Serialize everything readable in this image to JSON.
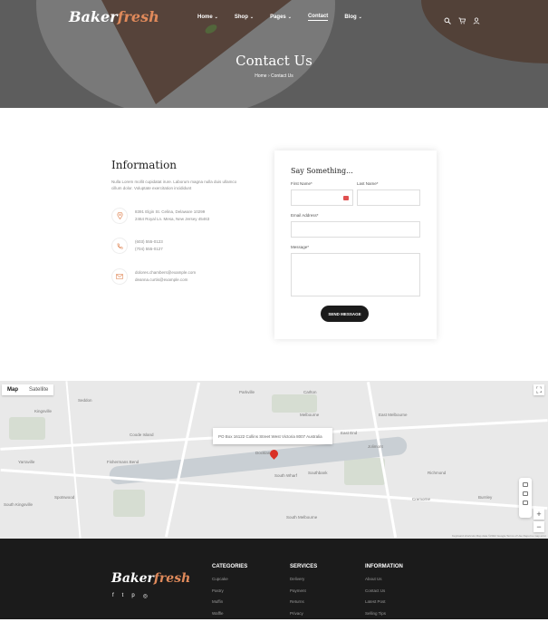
{
  "brand": {
    "name_main": "Baker",
    "name_accent": "fresh"
  },
  "nav": {
    "items": [
      {
        "label": "Home",
        "has_caret": true
      },
      {
        "label": "Shop",
        "has_caret": true
      },
      {
        "label": "Pages",
        "has_caret": true
      },
      {
        "label": "Contact",
        "has_caret": false,
        "active": true
      },
      {
        "label": "Blog",
        "has_caret": true
      }
    ],
    "icons": [
      "search-icon",
      "cart-icon",
      "user-icon"
    ]
  },
  "hero": {
    "title": "Contact Us",
    "breadcrumb": "Home › Contact Us"
  },
  "info": {
    "title": "Information",
    "description": "Nulla Lorem mollit cupidatat irure. Laborum magna nulla duis ullamco cillum dolor. Voluptate exercitation incididunt",
    "address": [
      "8391 Elgin St. Celina, Delaware 10299",
      "2464 Royal Ln. Mesa, New Jersey 45463"
    ],
    "phones": [
      "(603) 555-0123",
      "(704) 555-0127"
    ],
    "emails": [
      "dolores.chambers@example.com",
      "deanna.curtis@example.com"
    ]
  },
  "form": {
    "title": "Say Something...",
    "first_name_label": "First Name*",
    "last_name_label": "Last Name*",
    "email_label": "Email Address*",
    "message_label": "Message*",
    "submit_label": "SEND MESSAGE"
  },
  "map": {
    "tab_map": "Map",
    "tab_satellite": "Satellite",
    "info_address": "PO Box 16122 Collins Street West Victoria 8007 Australia",
    "labels": [
      "Seddon",
      "Kingsville",
      "Yarraville",
      "Spotswood",
      "South Kingsville",
      "Docklands",
      "South Wharf",
      "Southbank",
      "South Melbourne",
      "East Melbourne",
      "Jolimont",
      "Richmond",
      "Cremorne",
      "Burnley",
      "Melbourne",
      "Carlton",
      "Fishermans Bend",
      "Coode Island",
      "East End",
      "Parkville"
    ],
    "attribution": "Keyboard shortcuts  Map data ©2022 Google  Terms of Use  Report a map error"
  },
  "footer": {
    "social": [
      "f",
      "t",
      "p",
      "◎"
    ],
    "columns": [
      {
        "title": "CATEGORIES",
        "items": [
          "Cupcake",
          "Pastry",
          "Muffin",
          "Waffle"
        ]
      },
      {
        "title": "SERVICES",
        "items": [
          "Delivery",
          "Payment",
          "Returns",
          "Privacy"
        ]
      },
      {
        "title": "INFORMATION",
        "items": [
          "About Us",
          "Contact Us",
          "Latest Post",
          "Selling Tips"
        ]
      }
    ]
  },
  "colors": {
    "accent": "#e08a5b",
    "dark": "#1b1b1b",
    "pin": "#d93025"
  }
}
